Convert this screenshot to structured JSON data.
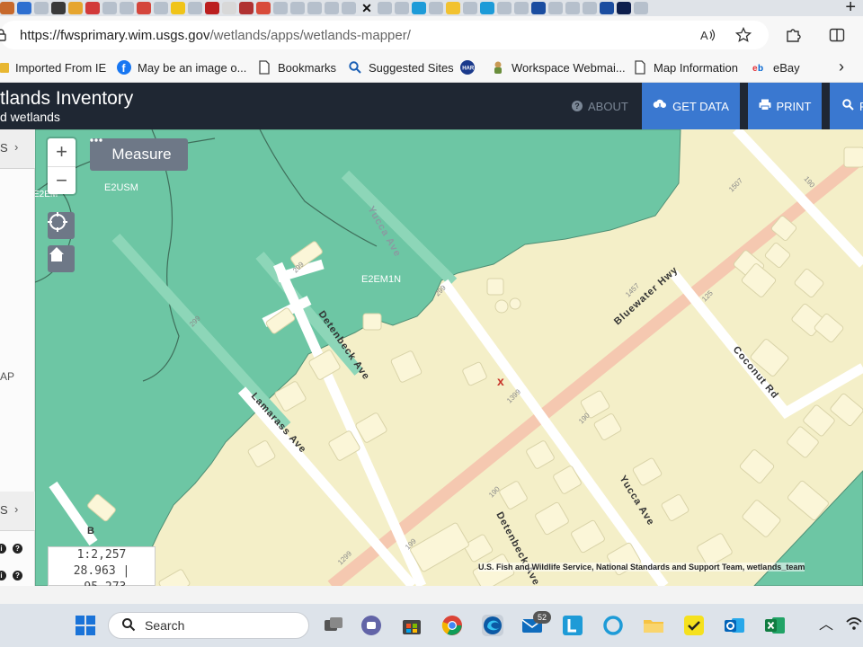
{
  "browser": {
    "url_host": "https://fwsprimary.wim.usgs.gov",
    "url_path": "/wetlands/apps/wetlands-mapper/",
    "tab_close_glyph": "✕",
    "new_tab_glyph": "+",
    "favorites": [
      {
        "label": "Imported From IE",
        "icon": "folder-icon",
        "color": "#e8b732"
      },
      {
        "label": "May be an image o...",
        "icon": "facebook-icon",
        "color": "#1877f2"
      },
      {
        "label": "Bookmarks",
        "icon": "page-icon",
        "color": "#444444"
      },
      {
        "label": "Suggested Sites",
        "icon": "search-icon",
        "color": "#1a5fb4"
      },
      {
        "label": "",
        "icon": "har-icon",
        "color": "#1b3a8c"
      },
      {
        "label": "Workspace Webmai...",
        "icon": "mascot-icon",
        "color": "#6a8e3c"
      },
      {
        "label": "Map Information",
        "icon": "page-icon",
        "color": "#444444"
      },
      {
        "label": "eBay",
        "icon": "ebay-icon",
        "color": "#e53238"
      }
    ]
  },
  "app": {
    "title": "tlands Inventory",
    "subtitle": "d wetlands",
    "about_label": "ABOUT",
    "get_data_label": "GET DATA",
    "print_label": "PRINT",
    "search_label": "F"
  },
  "sidebar": {
    "row1_label": "S",
    "row2_label": "S",
    "ap_label": "AP",
    "chevron": "›"
  },
  "map": {
    "measure_label": "Measure",
    "zoom_in": "+",
    "zoom_out": "−",
    "scale_label": "1:2,257",
    "coordinates": "28.963 | -95.273",
    "attribution": "U.S. Fish and Wildlife Service, National Standards and Support Team, wetlands_team",
    "marker": "x",
    "colors": {
      "wetland": "#6dc6a4",
      "upland": "#f4efc8",
      "road": "#ffffff",
      "highway": "#f5c8b0",
      "building": "#fbf6d8"
    },
    "wetland_codes": [
      "E2USM",
      "E2EM1N",
      "E2EM"
    ],
    "streets": [
      "Yucca Ave",
      "Detenbeck Ave",
      "Bluewater Hwy",
      "Coconut Rd",
      "Lamarass Ave",
      "Yucca Ave",
      "Detenbeck Ave"
    ],
    "addresses": [
      "299",
      "1399",
      "1457",
      "1507",
      "190",
      "125",
      "190",
      "190",
      "199",
      "1299",
      "299",
      "299",
      "B"
    ]
  },
  "taskbar": {
    "search_label": "Search",
    "mail_badge": "52"
  }
}
